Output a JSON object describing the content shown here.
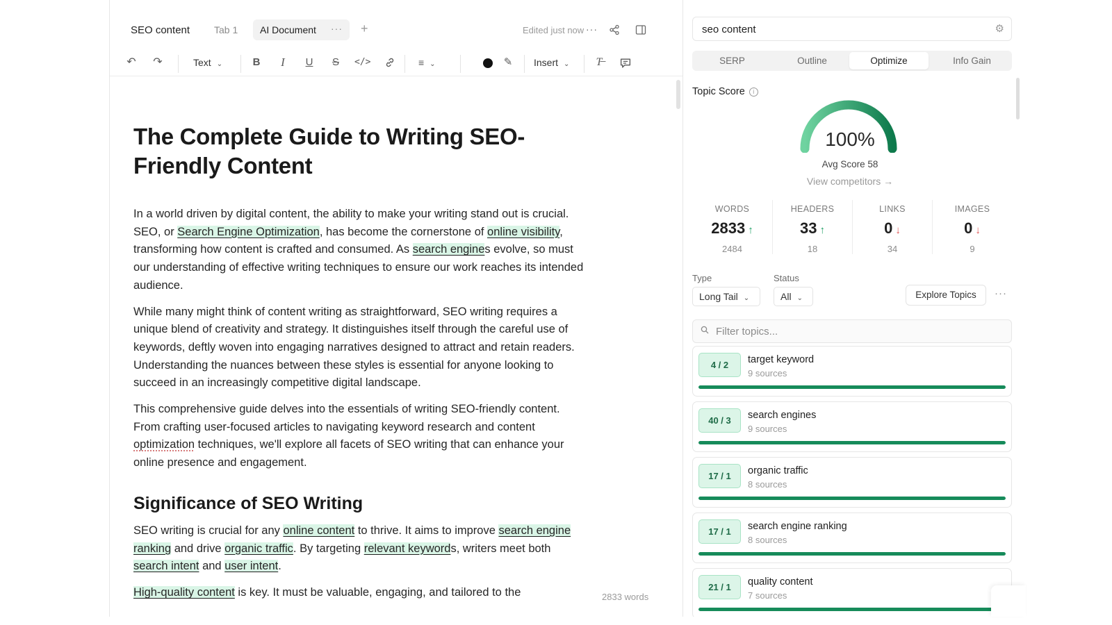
{
  "tabbar": {
    "doc_title": "SEO content",
    "tabs": [
      "Tab 1",
      "AI Document"
    ],
    "add": "+",
    "edited": "Edited just now",
    "more": "···"
  },
  "toolbar": {
    "text_label": "Text",
    "insert_label": "Insert",
    "text_color": "#111111"
  },
  "document": {
    "title": "The Complete Guide to Writing SEO-Friendly Content",
    "p1": {
      "t1": "In a world driven by digital content, the ability to make your writing stand out is crucial. SEO, or ",
      "k1": "Search Engine Optimization",
      "t2": ", has become the cornerstone of ",
      "k2": "online visibility",
      "t3": ", transforming how content is crafted and consumed. As ",
      "k3": "search engine",
      "t4": "s evolve, so must our understanding of effective writing techniques to ensure our work reaches its intended audience."
    },
    "p2": "While many might think of content writing as straightforward, SEO writing requires a unique blend of creativity and strategy. It distinguishes itself through the careful use of keywords, deftly woven into engaging narratives designed to attract and retain readers. Understanding the nuances between these styles is essential for anyone looking to succeed in an increasingly competitive digital landscape.",
    "p3": {
      "t1": "This comprehensive guide delves into the essentials of writing SEO-friendly content. From crafting user-focused articles to navigating keyword research and content ",
      "k1": "optimization",
      "t2": " techniques, we'll explore all facets of SEO writing that can enhance your online presence and engagement."
    },
    "h2": "Significance of SEO Writing",
    "p4": {
      "t1": "SEO writing is crucial for any ",
      "k1": "online content",
      "t2": " to thrive. It aims to improve ",
      "k2": "search engine ranking",
      "t3": " and drive ",
      "k3": "organic traffic",
      "t4": ". By targeting ",
      "k4": "relevant keyword",
      "t5": "s, writers meet both ",
      "k5": "search intent",
      "t6": " and ",
      "k6": "user intent",
      "t7": "."
    },
    "p5": {
      "k1": "High-quality content",
      "t1": " is key. It must be valuable, engaging, and tailored to the"
    },
    "word_count": "2833 words"
  },
  "panel": {
    "search": "seo content",
    "tabs": [
      "SERP",
      "Outline",
      "Optimize",
      "Info Gain"
    ],
    "active_tab": "Optimize",
    "topic_score_label": "Topic Score",
    "score": "100%",
    "score_fraction": 1.0,
    "avg_score": "Avg Score 58",
    "view_competitors": "View competitors →",
    "stats": [
      {
        "label": "WORDS",
        "value": "2833",
        "trend": "up",
        "sub": "2484"
      },
      {
        "label": "HEADERS",
        "value": "33",
        "trend": "up",
        "sub": "18"
      },
      {
        "label": "LINKS",
        "value": "0",
        "trend": "down",
        "sub": "34"
      },
      {
        "label": "IMAGES",
        "value": "0",
        "trend": "down",
        "sub": "9"
      }
    ],
    "type_label": "Type",
    "type_value": "Long Tail",
    "status_label": "Status",
    "status_value": "All",
    "explore_label": "Explore Topics",
    "filter_placeholder": "Filter topics...",
    "topics": [
      {
        "badge": "4 / 2",
        "name": "target keyword",
        "sources": "9 sources",
        "progress": 1.0
      },
      {
        "badge": "40 / 3",
        "name": "search engines",
        "sources": "9 sources",
        "progress": 1.0
      },
      {
        "badge": "17 / 1",
        "name": "organic traffic",
        "sources": "8 sources",
        "progress": 1.0
      },
      {
        "badge": "17 / 1",
        "name": "search engine ranking",
        "sources": "8 sources",
        "progress": 1.0
      },
      {
        "badge": "21 / 1",
        "name": "quality content",
        "sources": "7 sources",
        "progress": 1.0
      }
    ],
    "accent": "#168b5a",
    "up_color": "#1b9e63",
    "down_color": "#e05252"
  }
}
